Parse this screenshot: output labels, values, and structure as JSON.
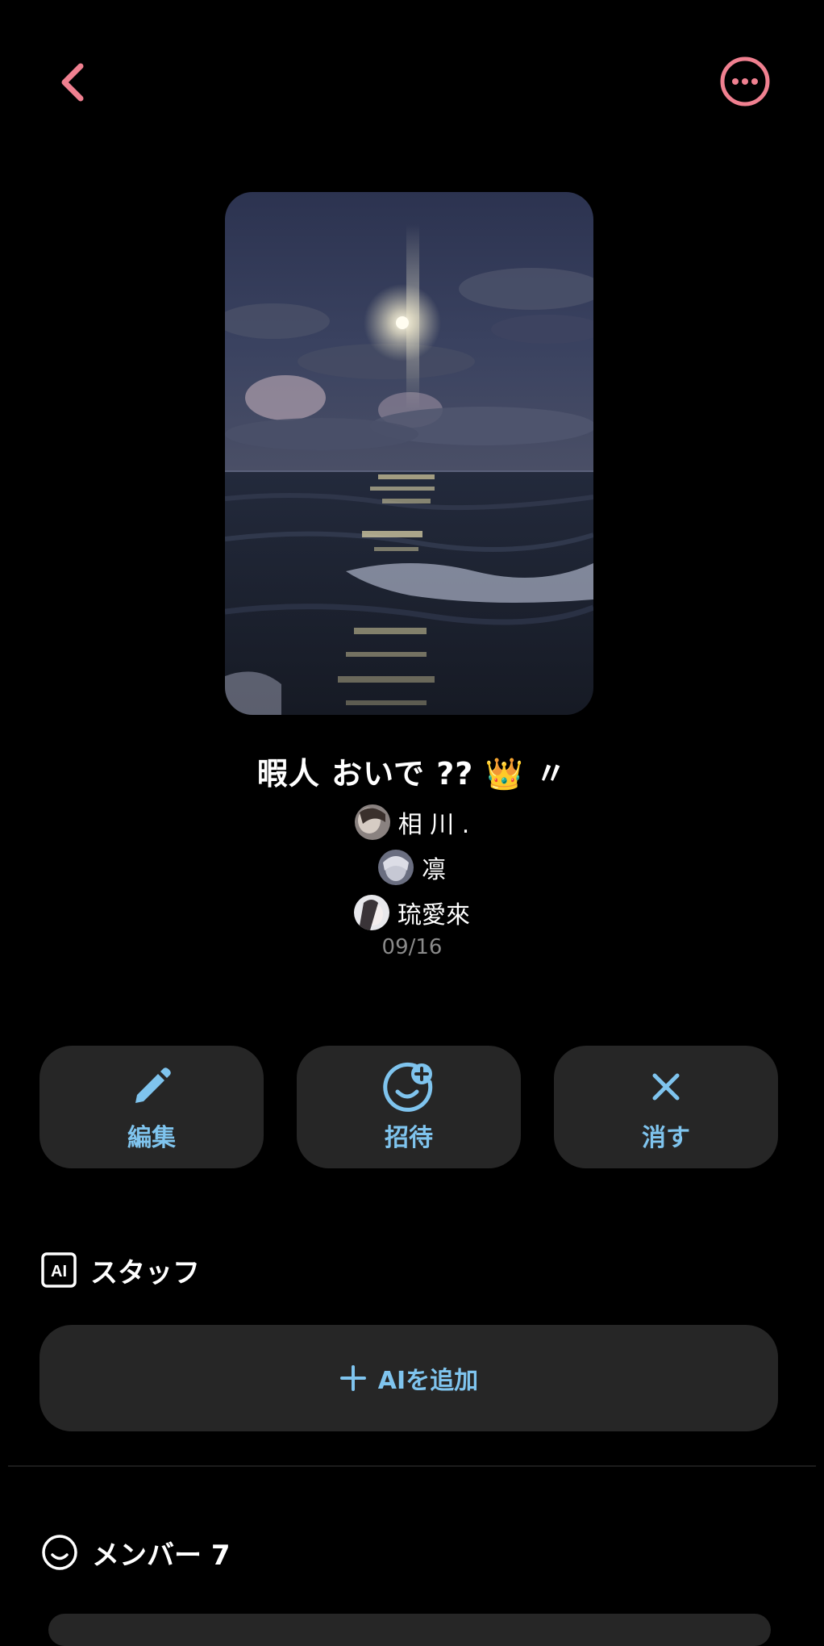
{
  "room": {
    "title": "暇人 おいで ?? 👑 〃",
    "hosts": [
      {
        "name": "相 川 ."
      },
      {
        "name": "凛"
      },
      {
        "name": "琉愛來"
      }
    ],
    "date": "09/16"
  },
  "actions": [
    {
      "label": "編集",
      "icon": "pencil-icon"
    },
    {
      "label": "招待",
      "icon": "smile-plus-icon"
    },
    {
      "label": "消す",
      "icon": "close-icon"
    }
  ],
  "staff": {
    "icon_text": "AI",
    "title": "スタッフ",
    "add_button": "AIを追加"
  },
  "members": {
    "title": "メンバー 7"
  },
  "colors": {
    "accent_pink": "#f08090",
    "accent_blue": "#7fc4ee",
    "card_bg": "#262626"
  }
}
